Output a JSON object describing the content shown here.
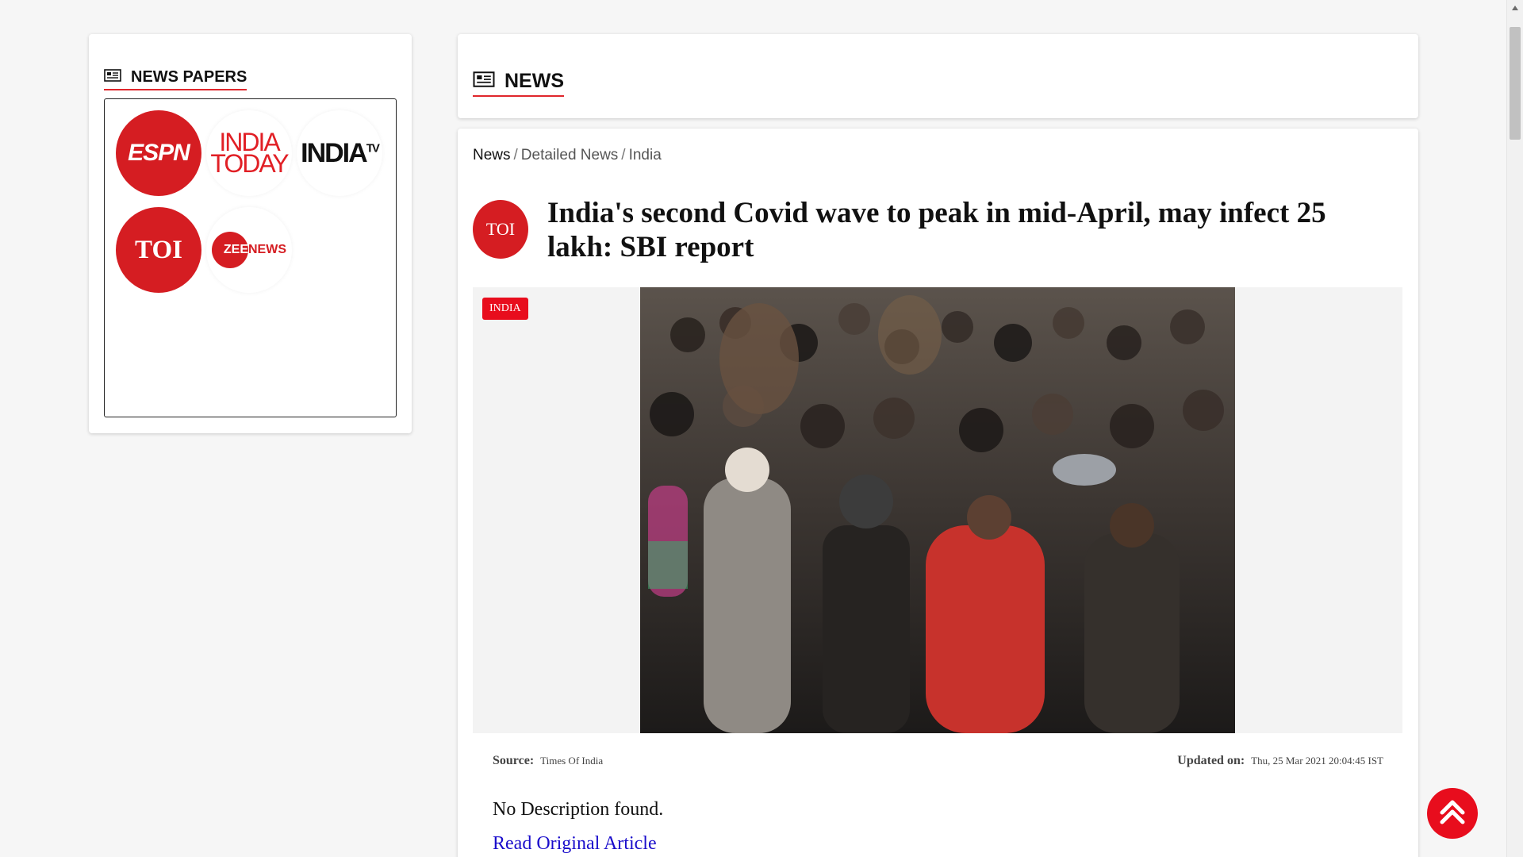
{
  "sidebar": {
    "heading": "NEWS PAPERS",
    "logos": [
      {
        "name": "espn",
        "text": "ESPN"
      },
      {
        "name": "india-today",
        "line1": "INDIA",
        "line2": "TODAY"
      },
      {
        "name": "india-tv",
        "text": "INDIA",
        "sup": "TV"
      },
      {
        "name": "toi",
        "text": "TOI"
      },
      {
        "name": "zee-news",
        "circle": "ZEE",
        "text": "NEWS"
      }
    ]
  },
  "header": {
    "heading": "NEWS"
  },
  "breadcrumb": [
    "News",
    "Detailed News",
    "India"
  ],
  "article": {
    "source_avatar": "TOI",
    "title": "India's second Covid wave to peak in mid-April, may infect 25 lakh: SBI report",
    "category": "INDIA",
    "source_label": "Source:",
    "source_value": "Times Of India",
    "updated_label": "Updated on:",
    "updated_value": "Thu, 25 Mar 2021 20:04:45 IST",
    "description": "No Description found.",
    "read_link": "Read Original Article"
  },
  "colors": {
    "accent": "#e80d1d",
    "link": "#1a0dcb"
  },
  "icons": {
    "news": "newspaper-icon",
    "top": "double-chevron-up-icon"
  }
}
